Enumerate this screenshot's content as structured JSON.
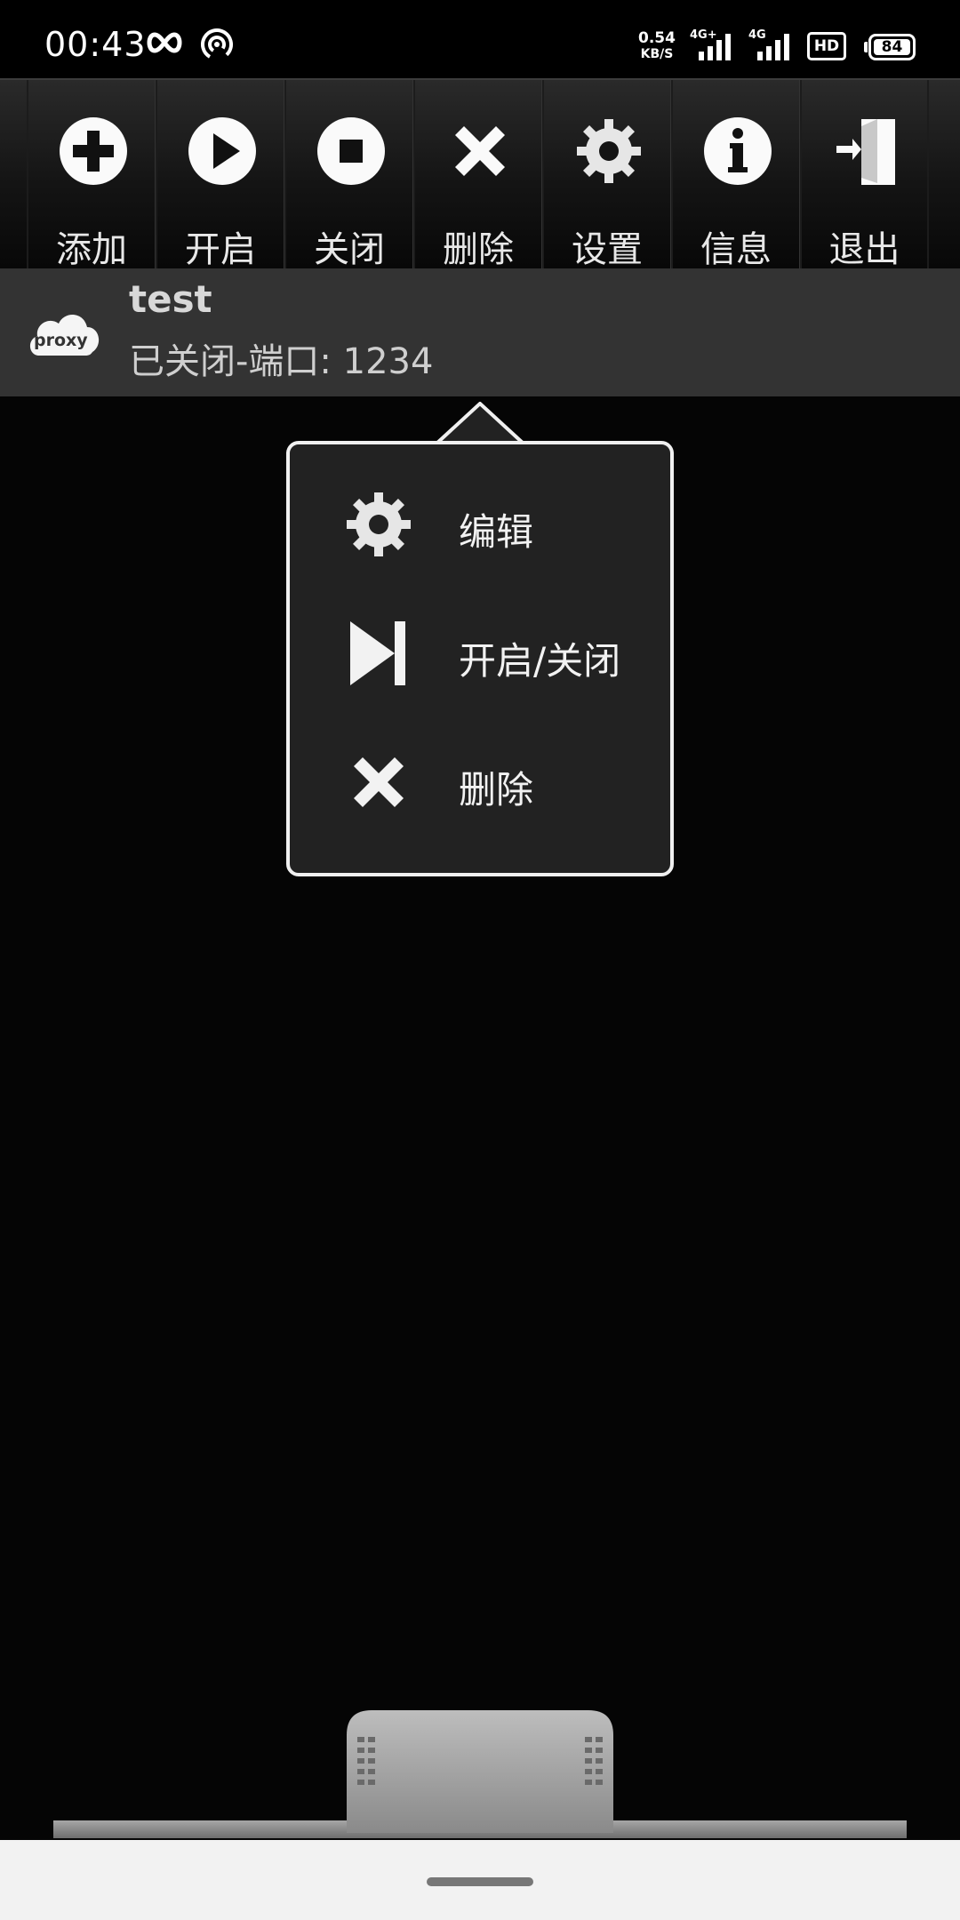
{
  "status_bar": {
    "time": "00:43",
    "speed_value": "0.54",
    "speed_unit": "KB/S",
    "signal1_label": "4G+",
    "signal2_label": "4G",
    "hd_label": "HD",
    "battery": "84"
  },
  "toolbar": {
    "items": [
      {
        "label": "添加",
        "icon": "add-icon"
      },
      {
        "label": "开启",
        "icon": "play-icon"
      },
      {
        "label": "关闭",
        "icon": "stop-icon"
      },
      {
        "label": "删除",
        "icon": "delete-icon"
      },
      {
        "label": "设置",
        "icon": "gear-icon"
      },
      {
        "label": "信息",
        "icon": "info-icon"
      },
      {
        "label": "退出",
        "icon": "exit-icon"
      }
    ]
  },
  "proxy_item": {
    "name": "test",
    "status": "已关闭-端口: 1234",
    "logo_text": "proxy"
  },
  "context_menu": {
    "items": [
      {
        "label": "编辑",
        "icon": "gear-icon"
      },
      {
        "label": "开启/关闭",
        "icon": "play-pause-icon"
      },
      {
        "label": "删除",
        "icon": "delete-icon"
      }
    ]
  },
  "colors": {
    "background": "#050505",
    "toolbar_top": "#2a2a2a",
    "list_item": "#333333",
    "popup_bg": "#222222",
    "popup_border": "#f0f0f0"
  }
}
